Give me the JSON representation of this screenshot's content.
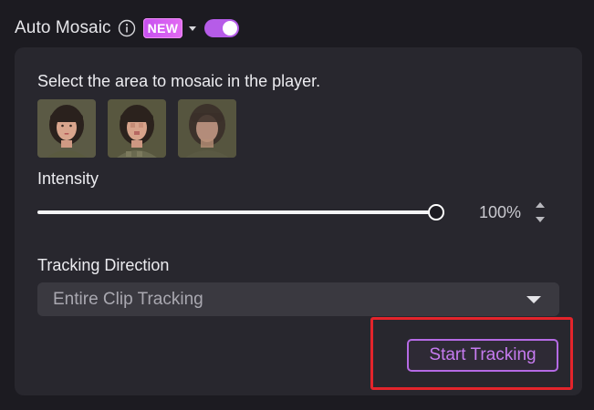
{
  "header": {
    "title": "Auto Mosaic",
    "info_icon": "info-icon",
    "badge": "NEW",
    "toggle_on": true,
    "colors": {
      "accent": "#b65ce8",
      "badge": "#d65cf2"
    }
  },
  "panel": {
    "hint": "Select the area to mosaic in the player.",
    "thumbnails": [
      {
        "kind": "face",
        "style": "clear"
      },
      {
        "kind": "face",
        "style": "pixelated"
      },
      {
        "kind": "face",
        "style": "blurred"
      }
    ],
    "intensity": {
      "label": "Intensity",
      "value_text": "100%",
      "value": 100
    },
    "tracking": {
      "label": "Tracking Direction",
      "selected": "Entire Clip Tracking"
    },
    "start_button": "Start Tracking",
    "colors": {
      "highlight": "#e3242b",
      "button_text": "#c67bf0"
    }
  }
}
